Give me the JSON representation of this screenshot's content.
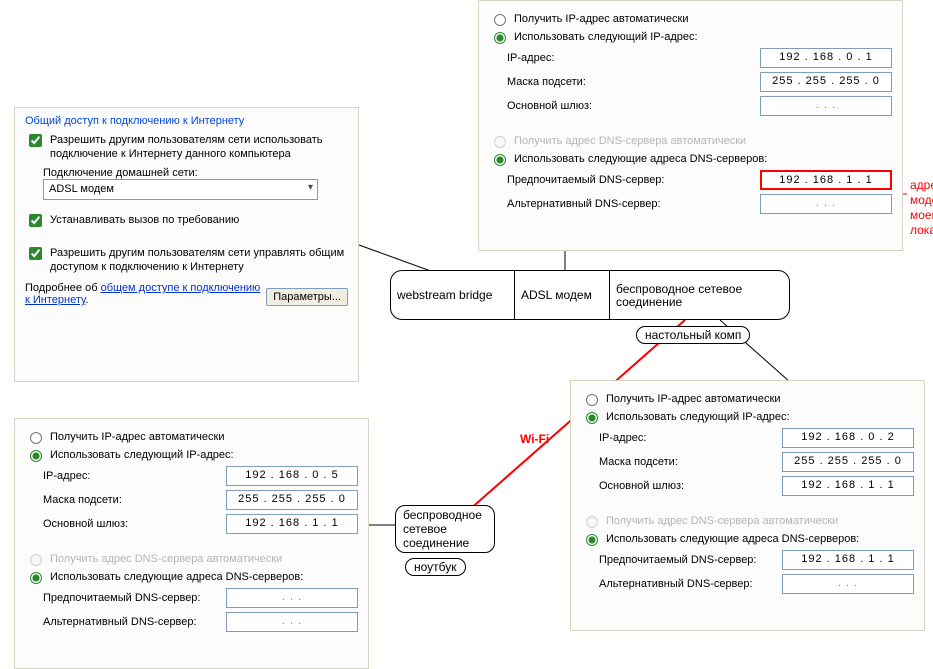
{
  "sharing": {
    "title": "Общий доступ к подключению к Интернету",
    "chk_allow": "Разрешить другим пользователям сети использовать подключение к Интернету данного компьютера",
    "home_net_label": "Подключение домашней сети:",
    "home_net_value": "ADSL модем",
    "chk_dial": "Устанавливать вызов по требованию",
    "chk_manage": "Разрешить другим пользователям сети управлять общим доступом к подключению к Интернету",
    "more_pre": "Подробнее об ",
    "more_link": "общем доступе к подключению к Интернету",
    "btn_params": "Параметры..."
  },
  "ip_labels": {
    "auto_ip": "Получить IP-адрес автоматически",
    "manual_ip": "Использовать следующий IP-адрес:",
    "ip": "IP-адрес:",
    "mask": "Маска подсети:",
    "gw": "Основной шлюз:",
    "auto_dns": "Получить адрес DNS-сервера автоматически",
    "manual_dns": "Использовать следующие адреса DNS-серверов:",
    "dns1": "Предпочитаемый DNS-сервер:",
    "dns2": "Альтернативный DNS-сервер:"
  },
  "ip_top": {
    "ip": "192 . 168 .   0  .   1",
    "mask": "255 . 255 . 255 .   0",
    "gw": "     .        .        .     ",
    "dns1": "192 . 168 .   1  .   1",
    "dns2": "     .        .        .     "
  },
  "ip_left": {
    "ip": "192 . 168 .   0  .   5",
    "mask": "255 . 255 . 255 .   0",
    "gw": "192 . 168 .   1  .   1",
    "dns1": "     .        .        .     ",
    "dns2": "     .        .        .     "
  },
  "ip_right": {
    "ip": "192 . 168 .   0  .   2",
    "mask": "255 . 255 . 255 .   0",
    "gw": "192 . 168 .   1  .   1",
    "dns1": "192 . 168 .   1  .   1",
    "dns2": "     .        .        .     "
  },
  "diagram": {
    "cell1": "webstream bridge",
    "cell2": "ADSL модем",
    "cell3": "беспроводное сетевое соединение",
    "desktop_label": "настольный комп",
    "wireless": "беспроводное сетевое соединение",
    "laptop": "ноутбук",
    "wifi": "Wi-Fi",
    "red_annot": "адрес\nмодема в\nмоей\nлокалке"
  }
}
